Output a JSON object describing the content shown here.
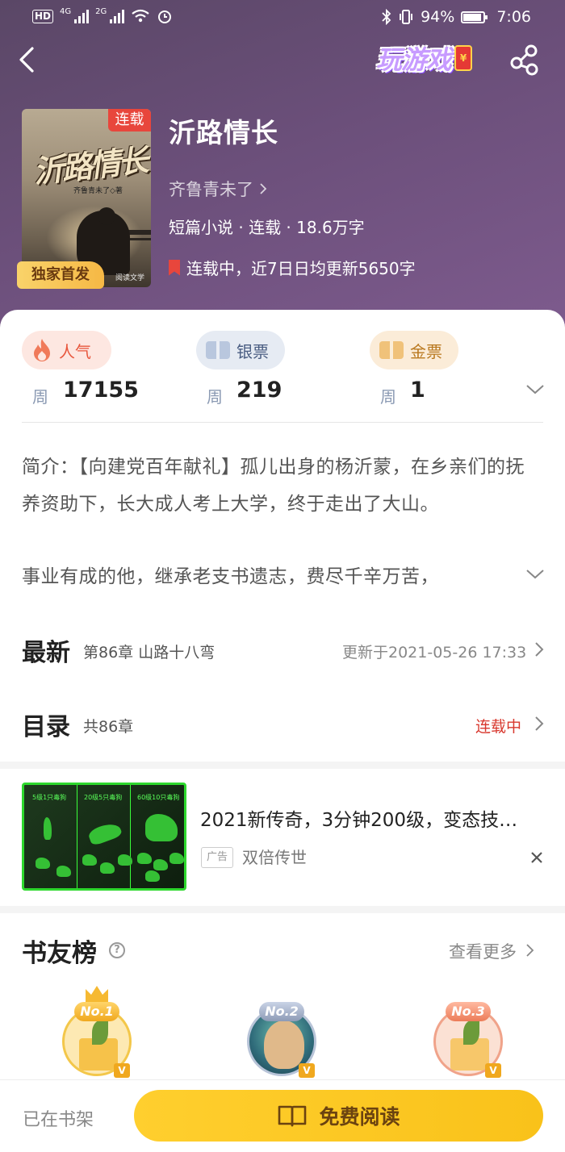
{
  "status_bar": {
    "left_hd": "HD",
    "left_net1": "4G",
    "left_net2": "2G",
    "battery": "94%",
    "time": "7:06"
  },
  "header": {
    "game_label": "玩游戏",
    "redpacket_symbol": "¥"
  },
  "book": {
    "cover_title": "沂路情长",
    "cover_author": "齐鲁青未了◇著",
    "cover_publisher": "阅读文学",
    "serial_tag": "连载",
    "exclusive_tag": "独家首发",
    "title": "沂路情长",
    "author": "齐鲁青未了",
    "meta": "短篇小说 · 连载 · 18.6万字",
    "update_info": "连载中，近7日日均更新5650字"
  },
  "tickets": [
    {
      "label": "人气",
      "period": "周",
      "value": "17155",
      "color": "#e8563c"
    },
    {
      "label": "银票",
      "period": "周",
      "value": "219",
      "color": "#4a5d82"
    },
    {
      "label": "金票",
      "period": "周",
      "value": "1",
      "color": "#b9781e"
    }
  ],
  "intro": {
    "text": "简介：【向建党百年献礼】孤儿出身的杨沂蒙，在乡亲们的抚养资助下，长大成人考上大学，终于走出了大山。",
    "line4": "事业有成的他，继承老支书遗志，费尽千辛万苦，"
  },
  "latest": {
    "title": "最新",
    "chapter": "第86章 山路十八弯",
    "updated": "更新于2021-05-26 17:33"
  },
  "catalog": {
    "title": "目录",
    "count": "共86章",
    "status": "连载中",
    "status_color": "#d8382e"
  },
  "ad": {
    "title": "2021新传奇，3分钟200级，变态技…",
    "badge": "广告",
    "source": "双倍传世",
    "image_labels": [
      "5级1只毒狗",
      "20级5只毒狗",
      "60级10只毒狗"
    ]
  },
  "friends": {
    "title": "书友榜",
    "help": "?",
    "see_more": "查看更多",
    "ranks": [
      {
        "badge": "No.1"
      },
      {
        "badge": "No.2"
      },
      {
        "badge": "No.3"
      }
    ],
    "v_mark": "V"
  },
  "bottom": {
    "on_shelf": "已在书架",
    "read_button": "免费阅读"
  }
}
